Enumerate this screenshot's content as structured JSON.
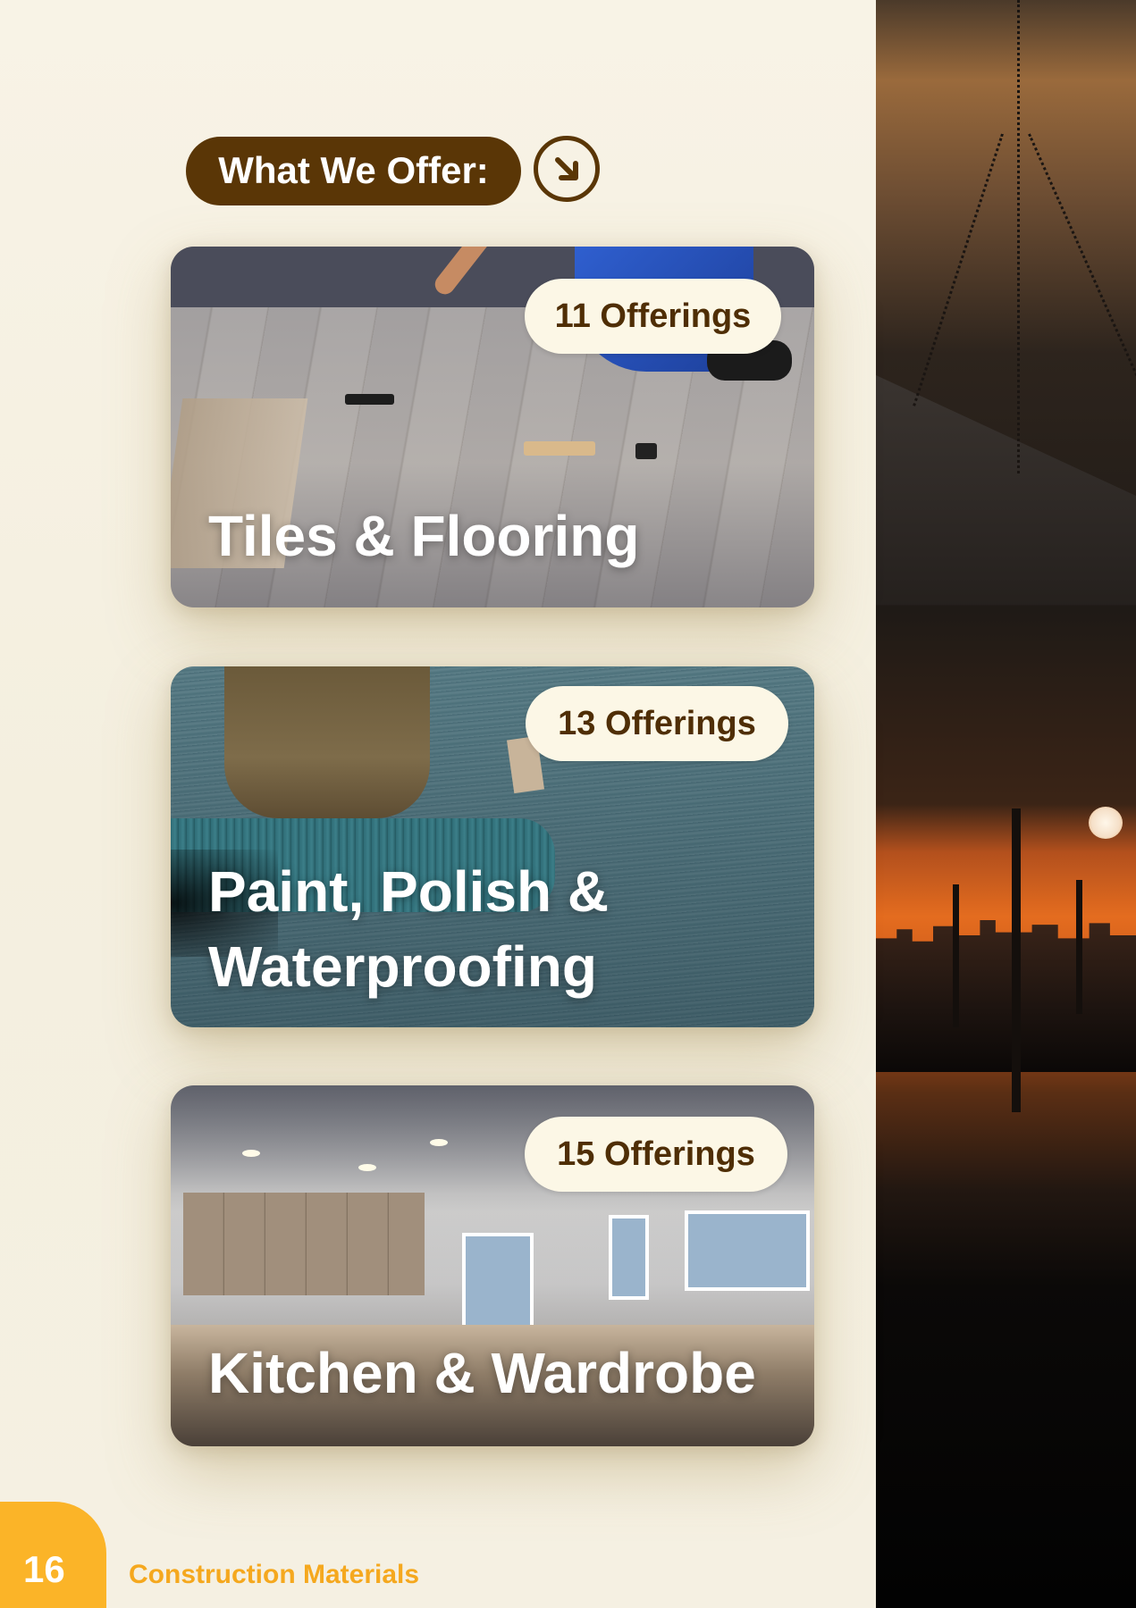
{
  "header": {
    "title": "What We Offer:",
    "arrow_icon": "arrow-down-right-icon"
  },
  "cards": [
    {
      "title": "Tiles & Flooring",
      "badge": "11 Offerings"
    },
    {
      "title": "Paint, Polish &\nWaterproofing",
      "badge": "13 Offerings"
    },
    {
      "title": "Kitchen & Wardrobe",
      "badge": "15 Offerings"
    }
  ],
  "footer": {
    "page_number": "16",
    "section": "Construction Materials"
  },
  "colors": {
    "brand_brown": "#5a3606",
    "accent_orange": "#fbb428",
    "page_background": "#f7f2e3"
  }
}
